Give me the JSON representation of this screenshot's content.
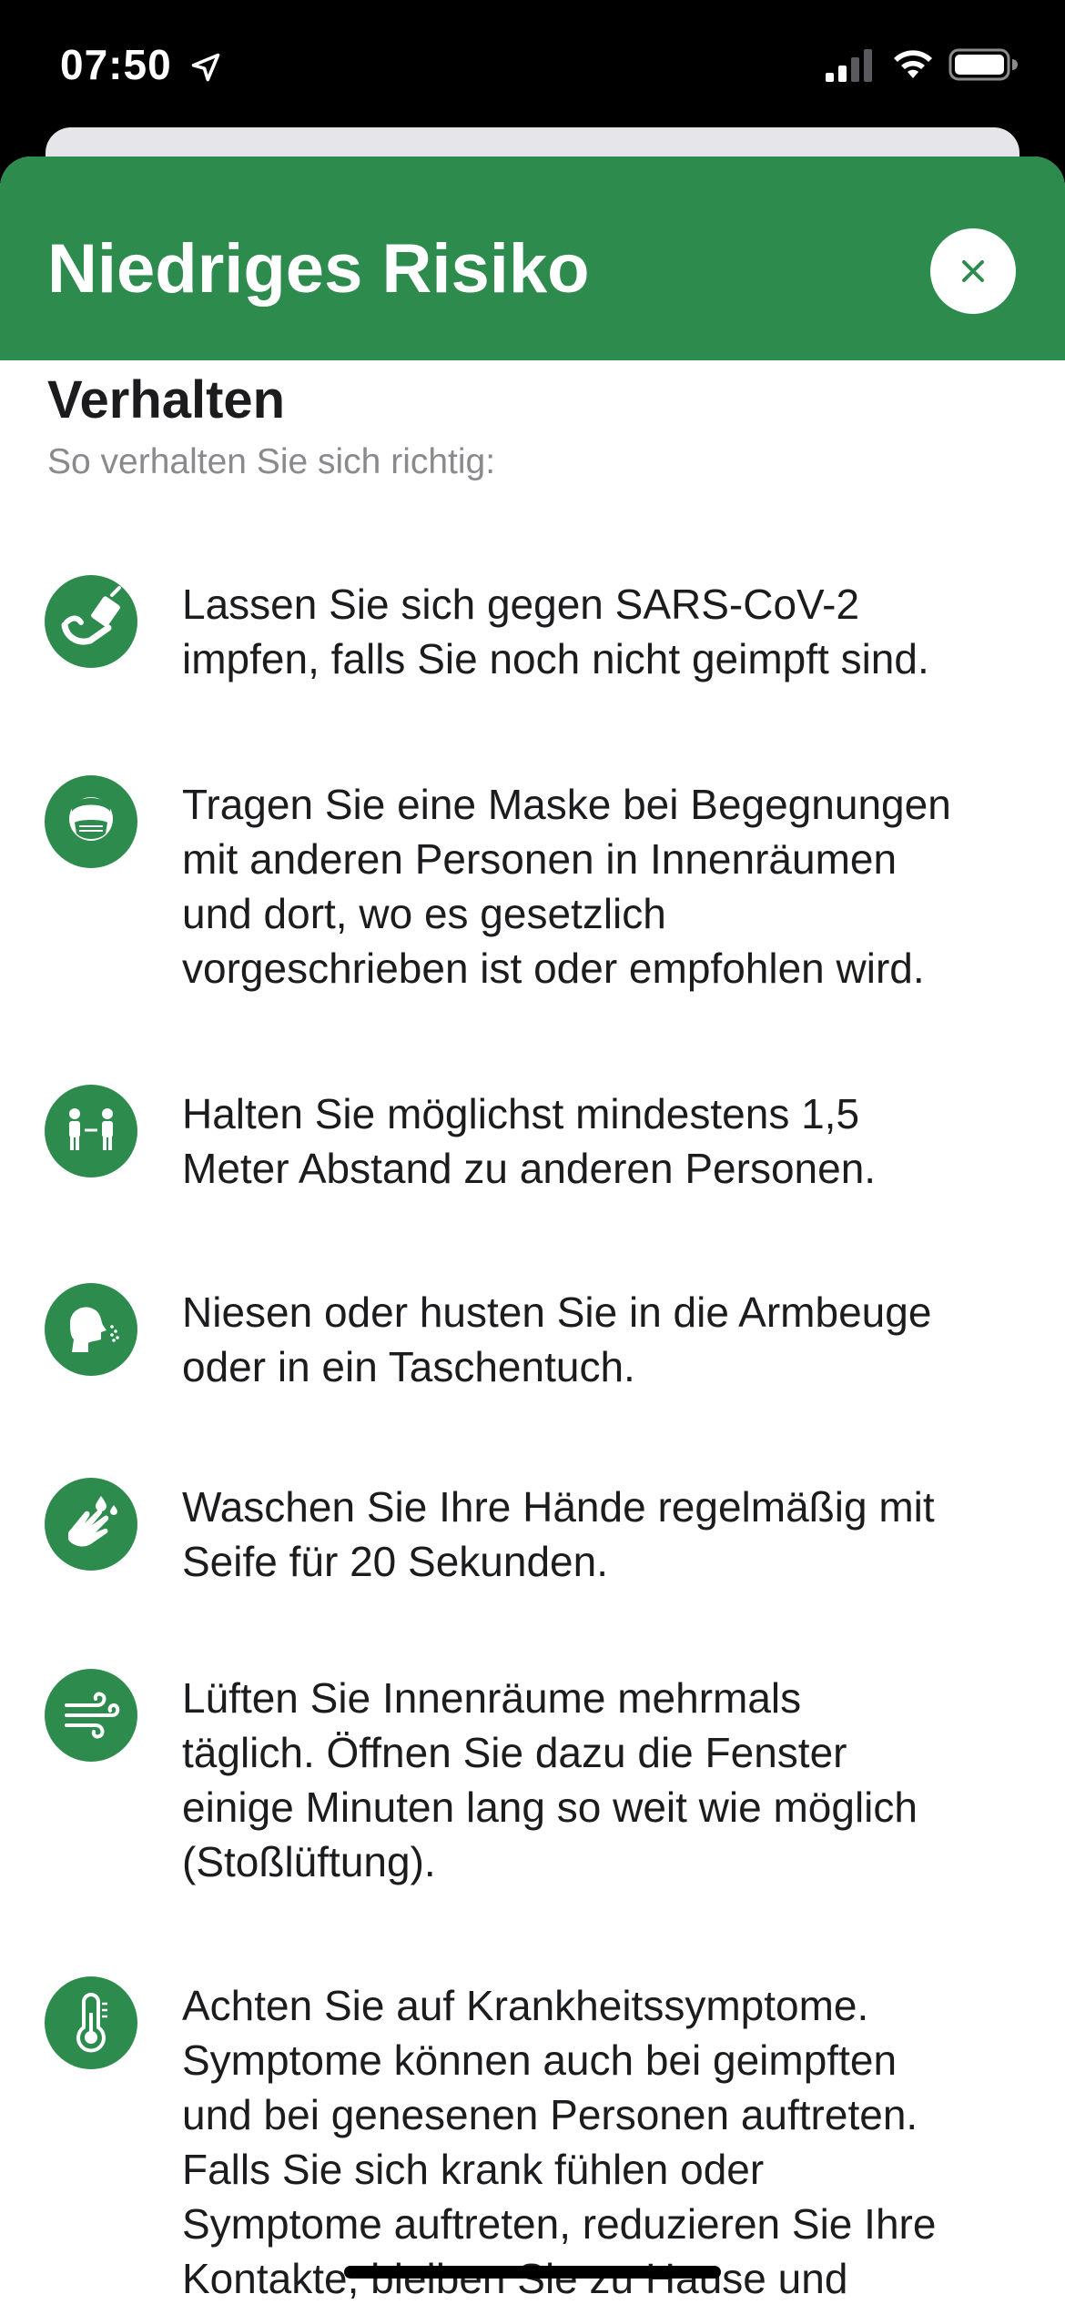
{
  "status_bar": {
    "time": "07:50"
  },
  "sheet": {
    "title": "Niedriges Risiko",
    "header_color": "#2e8b4e",
    "close_icon": "close-icon"
  },
  "section": {
    "title": "Verhalten",
    "subtitle": "So verhalten Sie sich richtig:"
  },
  "rules": [
    {
      "icon": "vaccination-icon",
      "text": "Lassen Sie sich gegen SARS-CoV-2\nimpfen, falls Sie noch nicht geimpft sind."
    },
    {
      "icon": "mask-icon",
      "text": "Tragen Sie eine Maske bei Begegnungen\nmit anderen Personen in Innenräumen\nund dort, wo es gesetzlich\nvorgeschrieben ist oder empfohlen wird."
    },
    {
      "icon": "distance-icon",
      "text": "Halten Sie möglichst mindestens 1,5\nMeter Abstand zu anderen Personen."
    },
    {
      "icon": "sneeze-icon",
      "text": "Niesen oder husten Sie in die Armbeuge\noder in ein Taschentuch."
    },
    {
      "icon": "handwash-icon",
      "text": "Waschen Sie Ihre Hände regelmäßig mit\nSeife für 20 Sekunden."
    },
    {
      "icon": "ventilation-icon",
      "text": "Lüften Sie Innenräume mehrmals\ntäglich. Öffnen Sie dazu die Fenster\neinige Minuten lang so weit wie möglich\n(Stoßlüftung)."
    },
    {
      "icon": "thermometer-icon",
      "text": "Achten Sie auf Krankheitssymptome.\nSymptome können auch bei geimpften\nund bei genesenen Personen auftreten.\nFalls Sie sich krank fühlen oder\nSymptome auftreten, reduzieren Sie Ihre\nKontakte, bleiben Sie zu Hause und"
    }
  ]
}
